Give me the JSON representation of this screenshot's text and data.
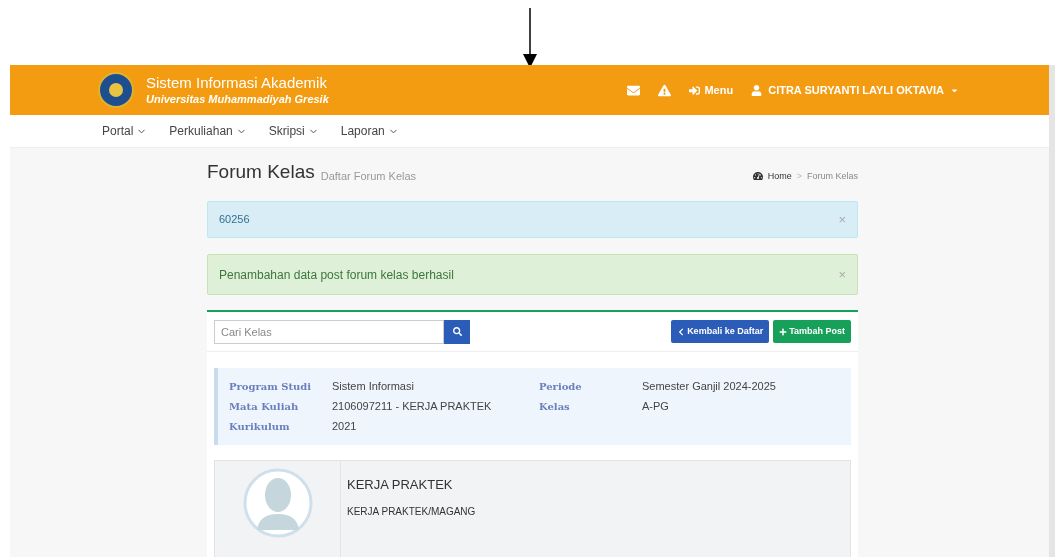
{
  "header": {
    "title": "Sistem Informasi Akademik",
    "subtitle": "Universitas Muhammadiyah Gresik",
    "menu_label": "Menu",
    "user_name": "CITRA SURYANTI LAYLI OKTAVIA"
  },
  "nav": [
    {
      "label": "Portal"
    },
    {
      "label": "Perkuliahan"
    },
    {
      "label": "Skripsi"
    },
    {
      "label": "Laporan"
    }
  ],
  "page": {
    "title": "Forum Kelas",
    "subtitle": "Daftar Forum Kelas",
    "breadcrumb": [
      "Home",
      "Forum Kelas"
    ],
    "breadcrumb_separator": ">"
  },
  "alerts": [
    {
      "kind": "info",
      "text": "60256",
      "close": "×"
    },
    {
      "kind": "success",
      "text": "Penambahan data post forum kelas berhasil",
      "close": "×"
    }
  ],
  "search": {
    "placeholder": "Cari Kelas"
  },
  "buttons": [
    {
      "kind": "back",
      "label": "Kembali ke Daftar"
    },
    {
      "kind": "add",
      "label": "Tambah Post"
    }
  ],
  "info": [
    {
      "label": "Program Studi",
      "value": "Sistem Informasi"
    },
    {
      "label": "Periode",
      "value": "Semester Ganjil 2024-2025"
    },
    {
      "label": "Mata Kuliah",
      "value": "2106097211 - KERJA PRAKTEK"
    },
    {
      "label": "Kelas",
      "value": "A-PG"
    },
    {
      "label": "Kurikulum",
      "value": "2021"
    }
  ],
  "post": {
    "title": "KERJA PRAKTEK",
    "body": "KERJA PRAKTEK/MAGANG"
  }
}
